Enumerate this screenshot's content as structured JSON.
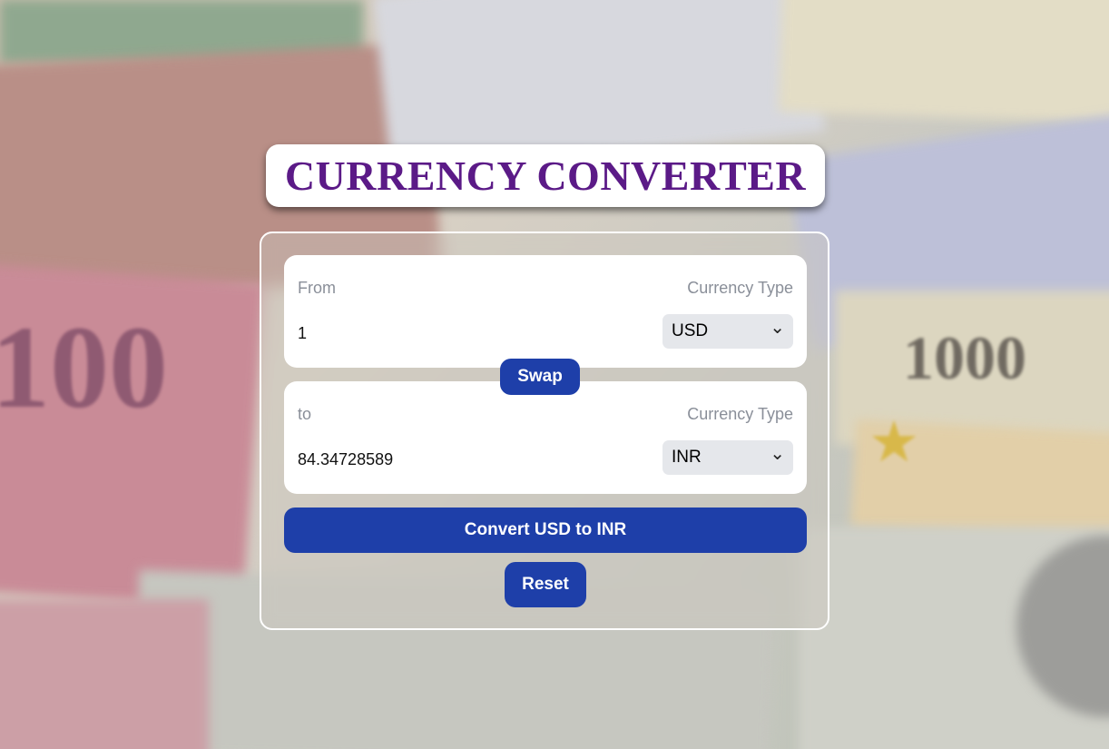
{
  "title": "CURRENCY CONVERTER",
  "from_panel": {
    "label": "From",
    "currency_label": "Currency Type",
    "amount": "1",
    "currency": "USD"
  },
  "swap_label": "Swap",
  "to_panel": {
    "label": "to",
    "currency_label": "Currency Type",
    "amount": "84.34728589",
    "currency": "INR"
  },
  "convert_label": "Convert USD to INR",
  "reset_label": "Reset",
  "colors": {
    "title": "#5b1a87",
    "button": "#1e3fa9",
    "select_bg": "#e5e7eb",
    "label": "#8a8f99"
  }
}
